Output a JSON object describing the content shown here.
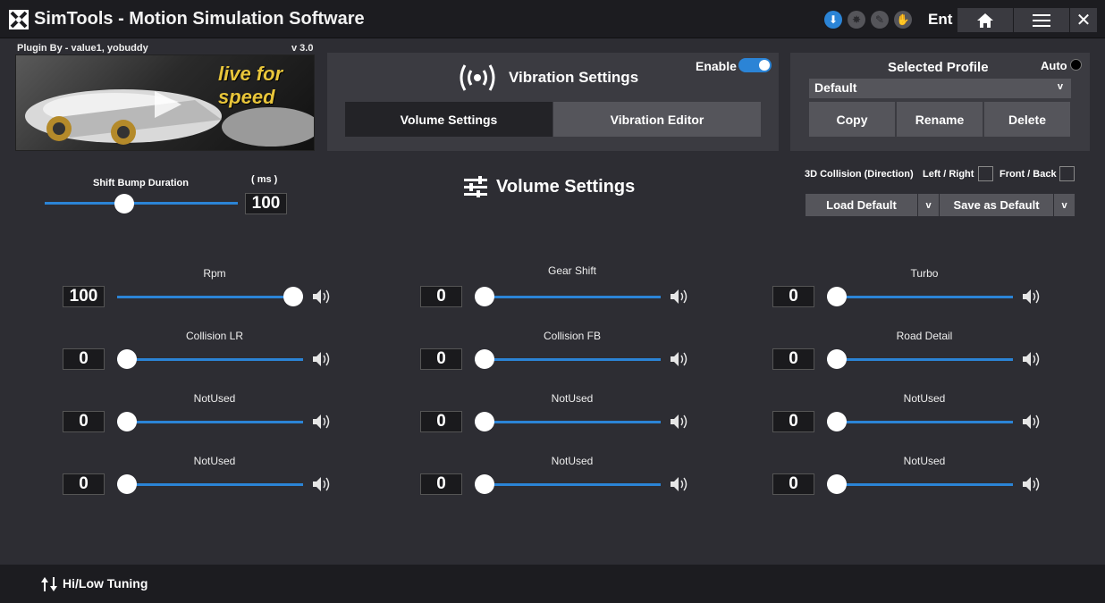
{
  "window": {
    "title": "SimTools - Motion Simulation Software",
    "mode_label": "Ent",
    "status_icons": [
      "power-on-icon",
      "sun-icon",
      "compass-icon",
      "hand-icon"
    ]
  },
  "plugin": {
    "by": "Plugin By - value1, yobuddy",
    "version": "v 3.0",
    "logo_text": "live for speed"
  },
  "vibration": {
    "title": "Vibration Settings",
    "enable_label": "Enable",
    "enabled": true,
    "tabs": [
      "Volume Settings",
      "Vibration Editor"
    ],
    "active_tab": 0
  },
  "profile": {
    "title": "Selected Profile",
    "auto_label": "Auto",
    "selected": "Default",
    "buttons": [
      "Copy",
      "Rename",
      "Delete"
    ]
  },
  "shift_bump": {
    "label": "Shift Bump Duration",
    "unit": "( ms )",
    "value": "100",
    "level": 0.4
  },
  "volume_section_title": "Volume Settings",
  "collision": {
    "label": "3D Collision (Direction)",
    "left_right": "Left / Right",
    "front_back": "Front / Back"
  },
  "defaults": {
    "load": "Load Default",
    "save": "Save as Default",
    "chevron": "v"
  },
  "channels": [
    {
      "label": "Rpm",
      "value": "100",
      "level": 1.0
    },
    {
      "label": "Gear Shift",
      "value": "0",
      "level": 0
    },
    {
      "label": "Turbo",
      "value": "0",
      "level": 0
    },
    {
      "label": "Collision LR",
      "value": "0",
      "level": 0
    },
    {
      "label": "Collision FB",
      "value": "0",
      "level": 0
    },
    {
      "label": "Road Detail",
      "value": "0",
      "level": 0
    },
    {
      "label": "NotUsed",
      "value": "0",
      "level": 0
    },
    {
      "label": "NotUsed",
      "value": "0",
      "level": 0
    },
    {
      "label": "NotUsed",
      "value": "0",
      "level": 0
    },
    {
      "label": "NotUsed",
      "value": "0",
      "level": 0
    },
    {
      "label": "NotUsed",
      "value": "0",
      "level": 0
    },
    {
      "label": "NotUsed",
      "value": "0",
      "level": 0
    }
  ],
  "bottom": {
    "tuning_label": "Hi/Low Tuning"
  },
  "colors": {
    "accent": "#2b84d6",
    "background": "#2d2d33",
    "panel": "#3b3b41"
  }
}
